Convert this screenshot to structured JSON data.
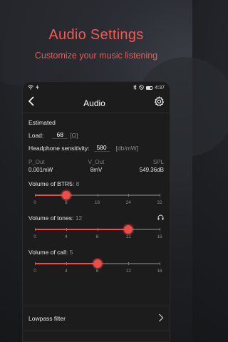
{
  "promo": {
    "title": "Audio Settings",
    "subtitle": "Customize your music listening"
  },
  "statusbar": {
    "time": "4:37",
    "icons": [
      "wifi-icon",
      "charging-icon",
      "bluetooth-icon",
      "silent-icon",
      "battery-icon"
    ]
  },
  "navbar": {
    "title": "Audio",
    "back_icon": "back-chevron-icon",
    "settings_icon": "gear-icon"
  },
  "estimated": {
    "heading": "Estimated",
    "load_label": "Load:",
    "load_value": "68",
    "load_unit": "[Ω]",
    "sensitivity_label": "Headphone sensitivity:",
    "sensitivity_value": "580",
    "sensitivity_unit": "[db/mW]",
    "p_out_label": "P_Out",
    "p_out_value": "0.001mW",
    "v_out_label": "V_Out",
    "v_out_value": "8mV",
    "spl_label": "SPL",
    "spl_value": "549.36dB"
  },
  "sliders": [
    {
      "label": "Volume of BTR5:",
      "value_text": "8",
      "value": 8,
      "max": 32,
      "ticks": [
        "0",
        "8",
        "16",
        "24",
        "32"
      ],
      "icon": ""
    },
    {
      "label": "Volume of tones:",
      "value_text": "12",
      "value": 12,
      "max": 16,
      "ticks": [
        "0",
        "4",
        "8",
        "12",
        "16"
      ],
      "icon": "headphones-icon"
    },
    {
      "label": "Volume of call:",
      "value_text": "5",
      "value": 8,
      "max": 16,
      "ticks": [
        "0",
        "4",
        "8",
        "12",
        "16"
      ],
      "icon": ""
    }
  ],
  "lowpass": {
    "label": "Lowpass filter",
    "icon": "chevron-right-icon"
  },
  "colors": {
    "accent": "#ee4c48",
    "promo_text": "#ef5a55"
  }
}
